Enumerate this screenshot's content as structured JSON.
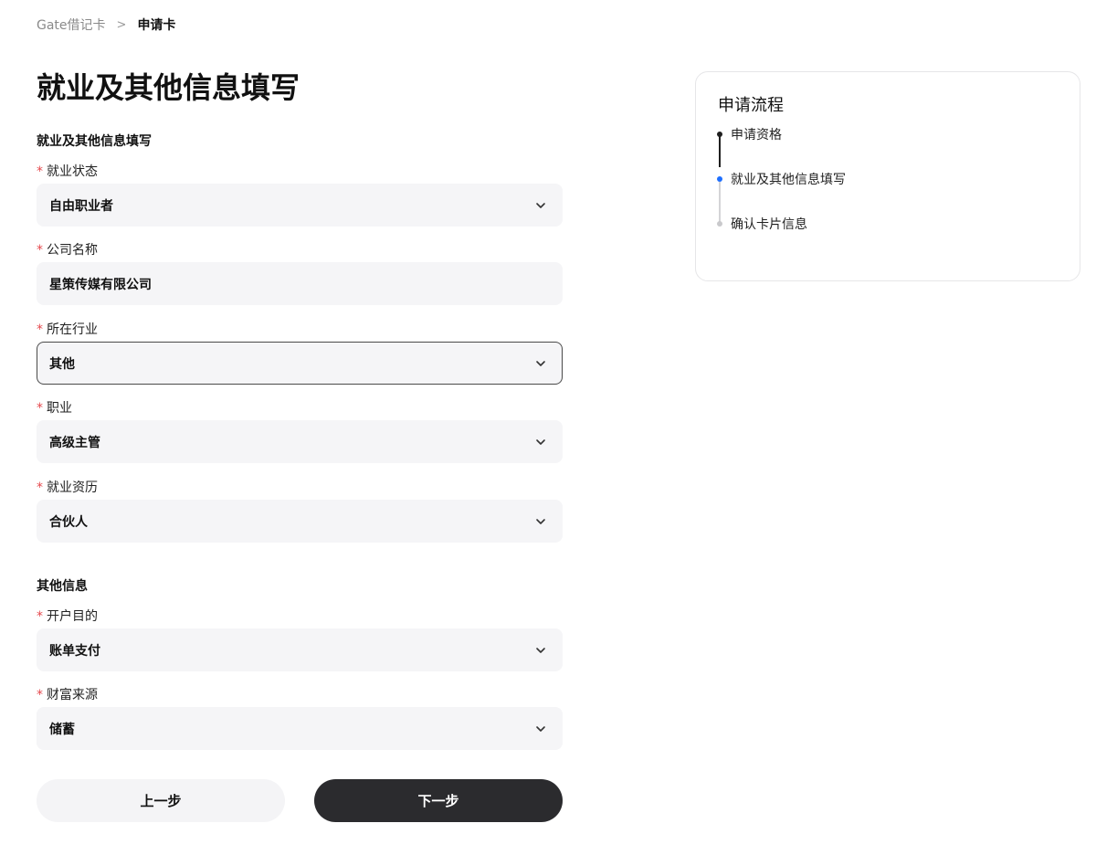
{
  "breadcrumb": {
    "parent": "Gate借记卡",
    "separator": ">",
    "current": "申请卡"
  },
  "page_title": "就业及其他信息填写",
  "sections": {
    "employment_title": "就业及其他信息填写",
    "other_title": "其他信息"
  },
  "required_mark": "*",
  "fields": {
    "employment_status": {
      "label": "就业状态",
      "value": "自由职业者"
    },
    "company_name": {
      "label": "公司名称",
      "value": "星策传媒有限公司"
    },
    "industry": {
      "label": "所在行业",
      "value": "其他"
    },
    "occupation": {
      "label": "职业",
      "value": "高级主管"
    },
    "work_experience": {
      "label": "就业资历",
      "value": "合伙人"
    },
    "account_purpose": {
      "label": "开户目的",
      "value": "账单支付"
    },
    "wealth_source": {
      "label": "财富来源",
      "value": "储蓄"
    }
  },
  "buttons": {
    "prev": "上一步",
    "next": "下一步"
  },
  "process": {
    "title": "申请流程",
    "steps": [
      {
        "label": "申请资格",
        "state": "done"
      },
      {
        "label": "就业及其他信息填写",
        "state": "current"
      },
      {
        "label": "确认卡片信息",
        "state": "pending"
      }
    ]
  },
  "colors": {
    "required": "#e5484d",
    "step_done": "#1f1f1f",
    "step_current": "#1e6fff",
    "step_pending": "#c9c9cc",
    "primary_button": "#2b2b2e"
  },
  "icons": {
    "dropdown": "chevron-down-icon"
  }
}
